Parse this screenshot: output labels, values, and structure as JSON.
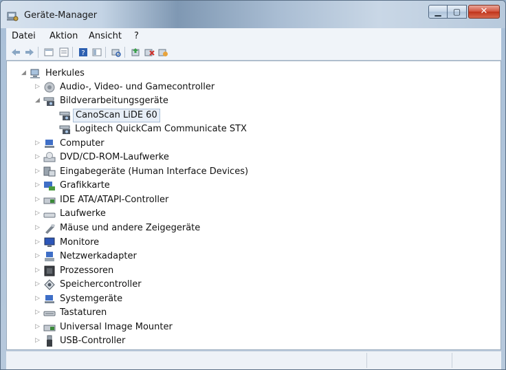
{
  "window": {
    "title": "Geräte-Manager",
    "title_icon": "device-manager-icon",
    "controls": {
      "minimize": "▁",
      "maximize": "▢",
      "close": "✕"
    }
  },
  "menu": [
    {
      "label": "Datei"
    },
    {
      "label": "Aktion"
    },
    {
      "label": "Ansicht"
    },
    {
      "label": "?"
    }
  ],
  "toolbar": [
    "back-arrow-icon",
    "forward-arrow-icon",
    "tree-view-icon",
    "properties-list-icon",
    "help-icon",
    "console-tree-icon",
    "scan-hardware-icon",
    "update-driver-icon",
    "uninstall-icon",
    "disable-icon"
  ],
  "tree": {
    "root": "Herkules",
    "items": [
      {
        "label": "Audio-, Video- und Gamecontroller",
        "icon": "speaker-icon",
        "expanded": false
      },
      {
        "label": "Bildverarbeitungsgeräte",
        "icon": "camera-icon",
        "expanded": true,
        "children": [
          {
            "label": "CanoScan LiDE 60",
            "icon": "scanner-icon",
            "selected": true
          },
          {
            "label": "Logitech QuickCam Communicate STX",
            "icon": "scanner-icon"
          }
        ]
      },
      {
        "label": "Computer",
        "icon": "computer-icon",
        "expanded": false
      },
      {
        "label": "DVD/CD-ROM-Laufwerke",
        "icon": "dvd-drive-icon",
        "expanded": false
      },
      {
        "label": "Eingabegeräte (Human Interface Devices)",
        "icon": "hid-icon",
        "expanded": false
      },
      {
        "label": "Grafikkarte",
        "icon": "display-adapter-icon",
        "expanded": false
      },
      {
        "label": "IDE ATA/ATAPI-Controller",
        "icon": "ide-controller-icon",
        "expanded": false
      },
      {
        "label": "Laufwerke",
        "icon": "disk-drive-icon",
        "expanded": false
      },
      {
        "label": "Mäuse und andere Zeigegeräte",
        "icon": "mouse-icon",
        "expanded": false
      },
      {
        "label": "Monitore",
        "icon": "monitor-icon",
        "expanded": false
      },
      {
        "label": "Netzwerkadapter",
        "icon": "network-adapter-icon",
        "expanded": false
      },
      {
        "label": "Prozessoren",
        "icon": "processor-icon",
        "expanded": false
      },
      {
        "label": "Speichercontroller",
        "icon": "storage-controller-icon",
        "expanded": false
      },
      {
        "label": "Systemgeräte",
        "icon": "system-devices-icon",
        "expanded": false
      },
      {
        "label": "Tastaturen",
        "icon": "keyboard-icon",
        "expanded": false
      },
      {
        "label": "Universal Image Mounter",
        "icon": "ide-controller-icon",
        "expanded": false
      },
      {
        "label": "USB-Controller",
        "icon": "usb-icon",
        "expanded": false
      }
    ]
  }
}
